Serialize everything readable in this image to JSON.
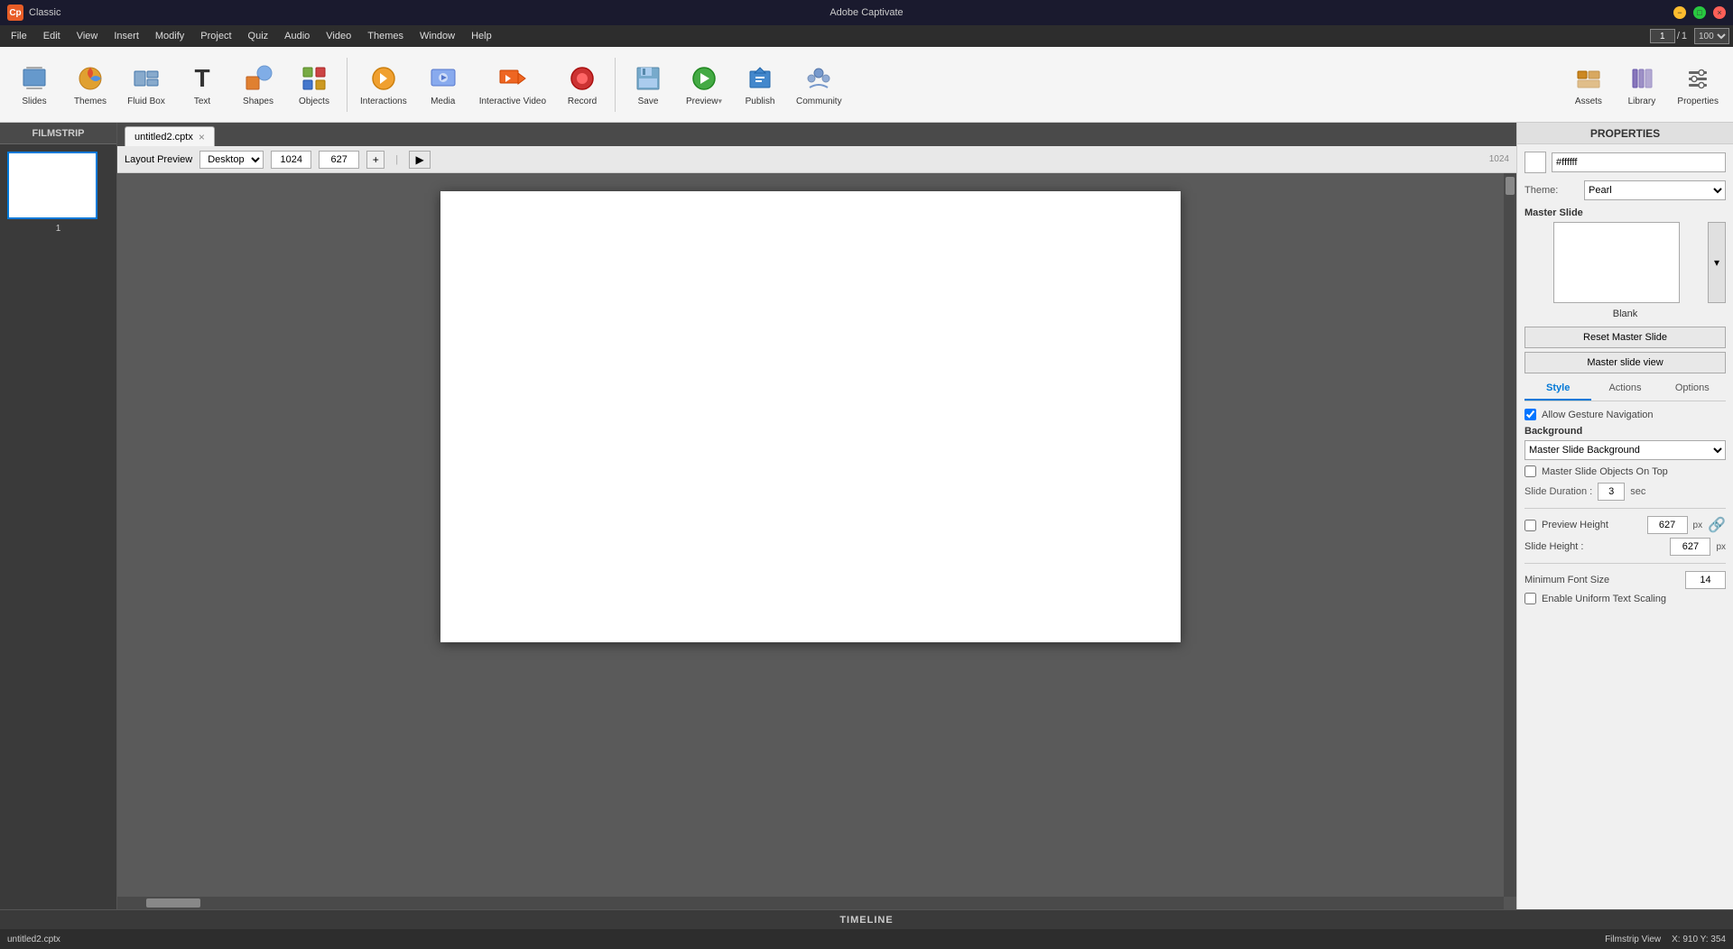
{
  "titlebar": {
    "app_name": "Adobe Captivate",
    "mode": "Classic",
    "window_controls": {
      "minimize": "−",
      "maximize": "□",
      "close": "×"
    }
  },
  "menubar": {
    "items": [
      "File",
      "Edit",
      "View",
      "Insert",
      "Modify",
      "Project",
      "Quiz",
      "Audio",
      "Video",
      "Themes",
      "Window",
      "Help"
    ]
  },
  "toolbar": {
    "slide_number_current": "1",
    "slide_number_total": "1",
    "zoom": "100",
    "buttons": [
      {
        "id": "slides",
        "label": "Slides",
        "icon": "slides-icon"
      },
      {
        "id": "themes",
        "label": "Themes",
        "icon": "themes-icon"
      },
      {
        "id": "fluid-box",
        "label": "Fluid Box",
        "icon": "fluid-icon"
      },
      {
        "id": "text",
        "label": "Text",
        "icon": "text-icon"
      },
      {
        "id": "shapes",
        "label": "Shapes",
        "icon": "shapes-icon"
      },
      {
        "id": "objects",
        "label": "Objects",
        "icon": "objects-icon"
      },
      {
        "id": "interactions",
        "label": "Interactions",
        "icon": "interactions-icon"
      },
      {
        "id": "media",
        "label": "Media",
        "icon": "media-icon"
      },
      {
        "id": "interactive-video",
        "label": "Interactive Video",
        "icon": "ivideo-icon"
      },
      {
        "id": "record",
        "label": "Record",
        "icon": "record-icon"
      },
      {
        "id": "save",
        "label": "Save",
        "icon": "save-icon"
      },
      {
        "id": "preview",
        "label": "Preview",
        "icon": "preview-icon"
      },
      {
        "id": "publish",
        "label": "Publish",
        "icon": "publish-icon"
      },
      {
        "id": "community",
        "label": "Community",
        "icon": "community-icon"
      }
    ],
    "right_buttons": [
      {
        "id": "assets",
        "label": "Assets",
        "icon": "assets-icon"
      },
      {
        "id": "library",
        "label": "Library",
        "icon": "library-icon"
      },
      {
        "id": "properties",
        "label": "Properties",
        "icon": "props-icon"
      }
    ]
  },
  "filmstrip": {
    "header": "FILMSTRIP",
    "slides": [
      {
        "number": "1"
      }
    ]
  },
  "document_tab": {
    "filename": "untitled2.cptx",
    "close_label": "×"
  },
  "layout_bar": {
    "label": "Layout Preview",
    "preset": "Desktop",
    "width": "1024",
    "height": "627",
    "ruler_value": "1024"
  },
  "canvas": {
    "background": "#5a5a5a"
  },
  "properties_panel": {
    "header": "PROPERTIES",
    "color_swatch": "#ffffff",
    "theme_label": "Theme:",
    "theme_value": "Pearl",
    "master_slide_label": "Master Slide",
    "master_slide_name": "Blank",
    "reset_btn": "Reset Master Slide",
    "master_view_btn": "Master slide view",
    "tabs": [
      {
        "id": "style",
        "label": "Style",
        "active": true
      },
      {
        "id": "actions",
        "label": "Actions",
        "active": false
      },
      {
        "id": "options",
        "label": "Options",
        "active": false
      }
    ],
    "allow_gesture": "Allow Gesture Navigation",
    "background_label": "Background",
    "background_value": "Master Slide Background",
    "master_objects_label": "Master Slide Objects On Top",
    "slide_duration_label": "Slide Duration :",
    "slide_duration_value": "3",
    "slide_duration_unit": "sec",
    "preview_height_label": "Preview Height",
    "preview_height_value": "627",
    "preview_height_unit": "px",
    "slide_height_label": "Slide Height :",
    "slide_height_value": "627",
    "slide_height_unit": "px",
    "min_font_size_label": "Minimum Font Size",
    "min_font_size_value": "14",
    "uniform_text_label": "Enable Uniform Text Scaling"
  },
  "timeline": {
    "label": "TIMELINE"
  },
  "status_bar": {
    "filename": "untitled2.cptx",
    "view_mode": "Filmstrip View",
    "coordinates": "X: 910 Y: 354"
  }
}
